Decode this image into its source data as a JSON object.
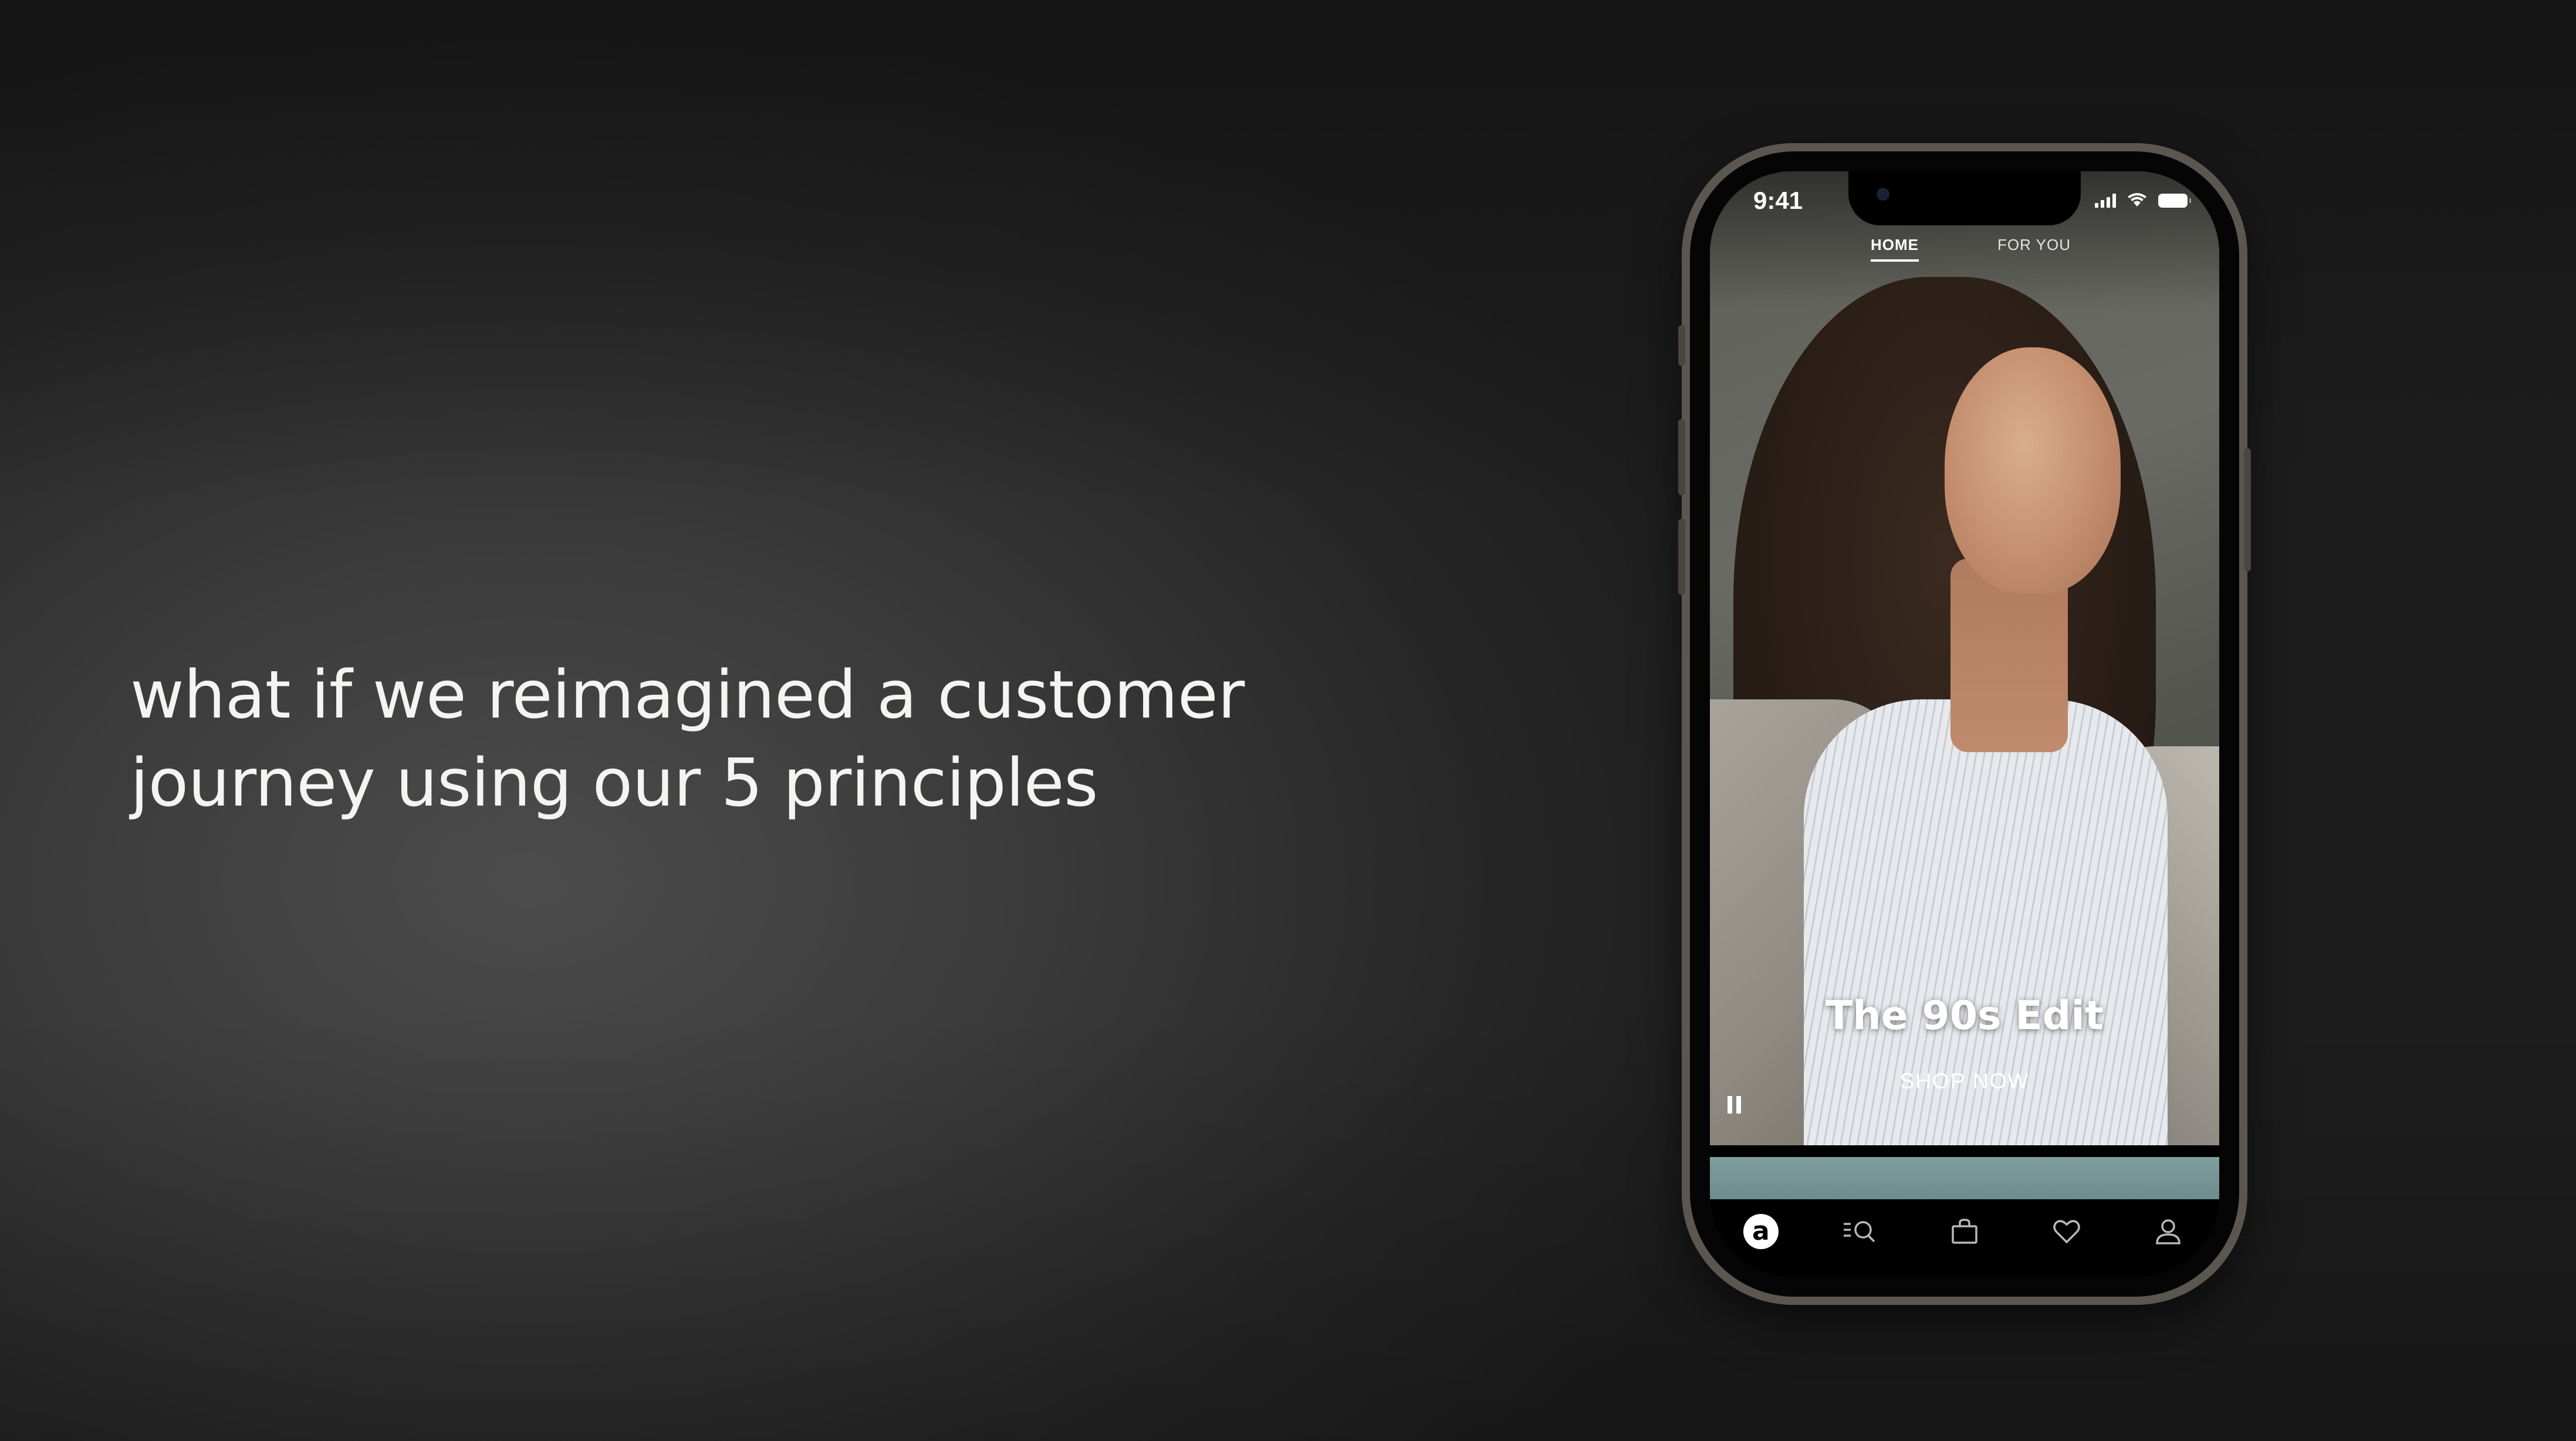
{
  "headline": "what if we reimagined a customer\njourney using our 5 principles",
  "phone": {
    "status_bar": {
      "time": "9:41",
      "icons": [
        "signal-icon",
        "wifi-icon",
        "battery-icon"
      ]
    },
    "top_tabs": [
      {
        "label": "HOME",
        "active": true
      },
      {
        "label": "FOR YOU",
        "active": false
      }
    ],
    "hero": {
      "title": "The 90s Edit",
      "cta": "SHOP NOW",
      "media_control": "pause-icon"
    },
    "bottom_nav": {
      "items": [
        {
          "name": "home",
          "icon": "brand-logo-icon",
          "glyph": "a",
          "active": true
        },
        {
          "name": "search",
          "icon": "search-icon"
        },
        {
          "name": "bag",
          "icon": "bag-icon"
        },
        {
          "name": "saved",
          "icon": "heart-icon"
        },
        {
          "name": "account",
          "icon": "user-icon"
        }
      ]
    }
  },
  "colors": {
    "background": "#2e2e2e",
    "text": "#f4f4f2",
    "phone_frame": "#5c5650",
    "accent_strip": "#7f9e9d"
  }
}
